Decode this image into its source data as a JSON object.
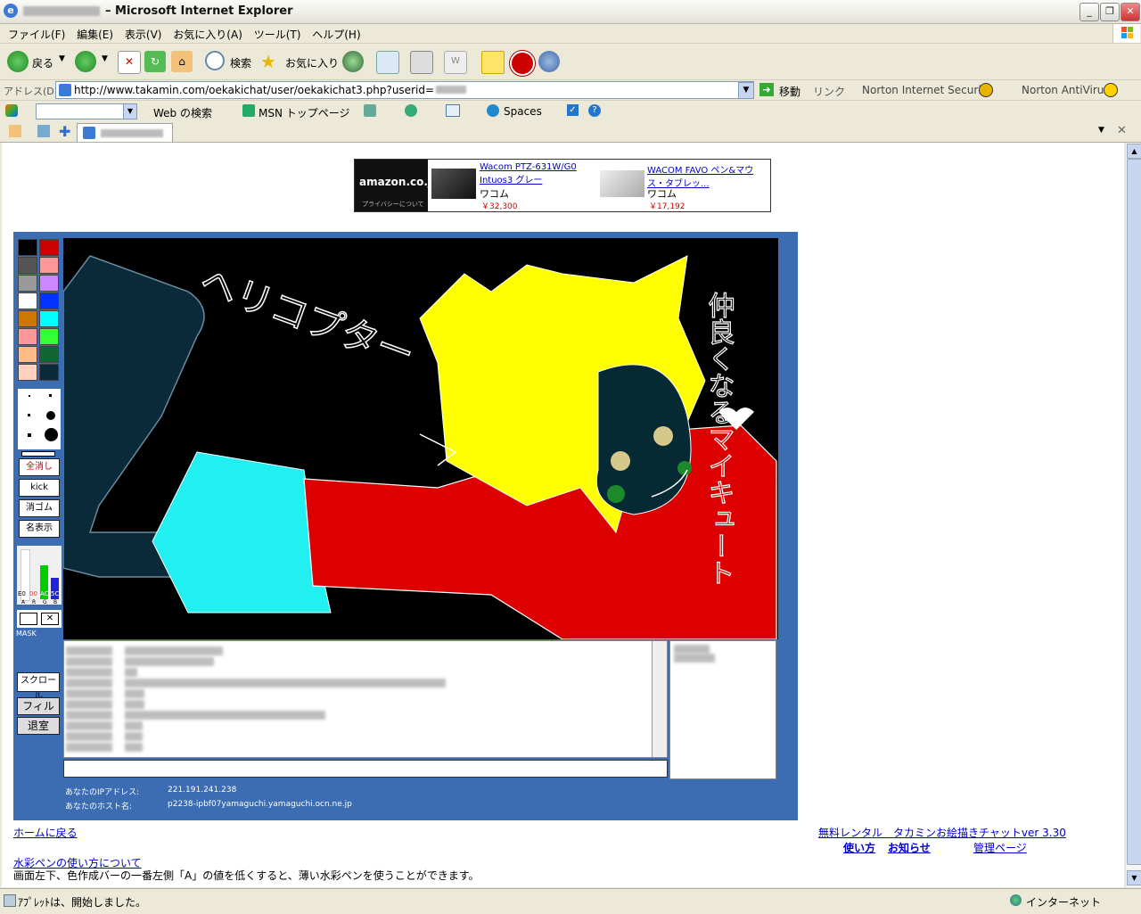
{
  "window": {
    "title": "– Microsoft Internet Explorer",
    "controls": [
      "_",
      "❐",
      "✕"
    ]
  },
  "menu": [
    "ファイル(F)",
    "編集(E)",
    "表示(V)",
    "お気に入り(A)",
    "ツール(T)",
    "ヘルプ(H)"
  ],
  "toolbar": {
    "back": "戻る",
    "search": "検索",
    "favorites": "お気に入り"
  },
  "address": {
    "label": "アドレス(D)",
    "url": "http://www.takamin.com/oekakichat/user/oekakichat3.php?userid=",
    "go": "移動",
    "links": "リンク",
    "norton_security": "Norton Internet Security",
    "norton_antivirus": "Norton AntiVirus"
  },
  "linksbar": {
    "web_search": "Web の検索",
    "msn": "MSN トップページ",
    "spaces": "Spaces"
  },
  "ad": {
    "logo": "amazon.co.jp",
    "privacy": "プライバシーについて",
    "item1": {
      "title": "Wacom PTZ-631W/G0 Intuos3 グレー",
      "maker": "ワコム",
      "price": "￥32,300"
    },
    "item2": {
      "title": "WACOM FAVO ペン&マウス・タブレッ...",
      "maker": "ワコム",
      "price": "￥17,192"
    }
  },
  "oekaki": {
    "palette": [
      "#000000",
      "#cc0000",
      "#555555",
      "#ff9999",
      "#999999",
      "#cc88ff",
      "#ffffff",
      "#0033ff",
      "#cc7700",
      "#00ffff",
      "#ff9999",
      "#33ff33",
      "#ffbb88",
      "#116633",
      "#ffd0c0",
      "#0a2a3a"
    ],
    "buttons": {
      "clear": "全消し",
      "kick": "kick",
      "eraser": "消ゴム",
      "name_display": "名表示",
      "scroll": "スクロール",
      "filter": "フィルタ",
      "leave": "退室"
    },
    "mask_label": "MASK",
    "color_bar_values": [
      "E0",
      "00",
      "AC",
      "5C"
    ],
    "color_bar_letters": [
      "A",
      "R",
      "G",
      "B"
    ],
    "canvas_text": {
      "left": "ヘリコプター",
      "right": "仲良くなるマイキュート"
    },
    "ip_label": "あなたのIPアドレス:",
    "ip_value": "221.191.241.238",
    "host_label": "あなたのホスト名:",
    "host_value": "p2238-ipbf07yamaguchi.yamaguchi.ocn.ne.jp"
  },
  "footer": {
    "home": "ホームに戻る",
    "rental": "無料レンタル　タカミンお絵描きチャットver 3.30",
    "usage": "使い方",
    "notice": "お知らせ",
    "admin": "管理ページ",
    "watercolor_link": "水彩ペンの使い方について",
    "watercolor_desc": "画面左下、色作成バーの一番左側「A」の値を低くすると、薄い水彩ペンを使うことができます。"
  },
  "status": {
    "text": "ｱﾌﾟﾚｯﾄは、開始しました。",
    "zone": "インターネット"
  }
}
